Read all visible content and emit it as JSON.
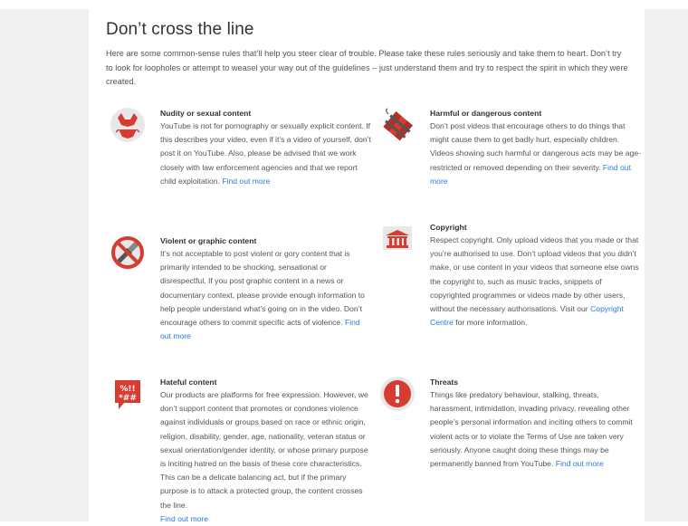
{
  "page": {
    "title": "Don’t cross the line",
    "intro": "Here are some common-sense rules that’ll help you steer clear of trouble. Please take these rules seriously and take them to heart. Don’t try to look for loopholes or attempt to weasel your way out of the guidelines – just understand them and try to respect the spirit in which they were created."
  },
  "sections": {
    "nudity": {
      "icon": "bikini-icon",
      "title": "Nudity or sexual content",
      "body": "YouTube is not for pornography or sexually explicit content. If this describes your video, even if it’s a video of yourself, don’t post it on YouTube. Also, please be advised that we work closely with law enforcement agencies and that we report child exploitation.",
      "link": "Find out more"
    },
    "harmful": {
      "icon": "dynamite-icon",
      "title": "Harmful or dangerous content",
      "body": "Don’t post videos that encourage others to do things that might cause them to get badly hurt, especially children. Videos showing such harmful or dangerous acts may be age-restricted or removed depending on their severity.",
      "link": "Find out more"
    },
    "violent": {
      "icon": "no-knife-icon",
      "title": "Violent or graphic content",
      "body": "It’s not acceptable to post violent or gory content that is primarily intended to be shocking, sensational or disrespectful. If you post graphic content in a news or documentary context, please provide enough information to help people understand what’s going on in the video. Don’t encourage others to commit specific acts of violence.",
      "link": "Find out more"
    },
    "copyright": {
      "icon": "courthouse-icon",
      "title": "Copyright",
      "body_before": "Respect copyright. Only upload videos that you made or that you’re authorised to use. Don’t upload videos that you didn’t make, or use content in your videos that someone else owns the copyright to, such as music tracks, snippets of copyrighted programmes or videos made by other users, without the necessary authorisations. Visit our",
      "link": "Copyright Centre",
      "body_after": "for more information."
    },
    "hateful": {
      "icon": "speech-bubble-symbols-icon",
      "title": "Hateful content",
      "body": "Our products are platforms for free expression. However, we don’t support content that promotes or condones violence against individuals or groups based on race or ethnic origin, religion, disability, gender, age, nationality, veteran status or sexual orientation/gender identity, or whose primary purpose is inciting hatred on the basis of these core characteristics. This can be a delicate balancing act, but if the primary purpose is to attack a protected group, the content crosses the line.",
      "link": "Find out more"
    },
    "threats": {
      "icon": "exclamation-icon",
      "title": "Threats",
      "body": "Things like predatory behaviour, stalking, threats, harassment, intimidation, invading privacy, revealing other people’s personal information and inciting others to commit violent acts or to violate the Terms of Use are taken very seriously. Anyone caught doing these things may be permanently banned from YouTube.",
      "link": "Find out more"
    }
  },
  "colors": {
    "accent_red": "#d63c31",
    "link_blue": "#2a7ae2",
    "icon_gray": "#e8e8e8"
  }
}
